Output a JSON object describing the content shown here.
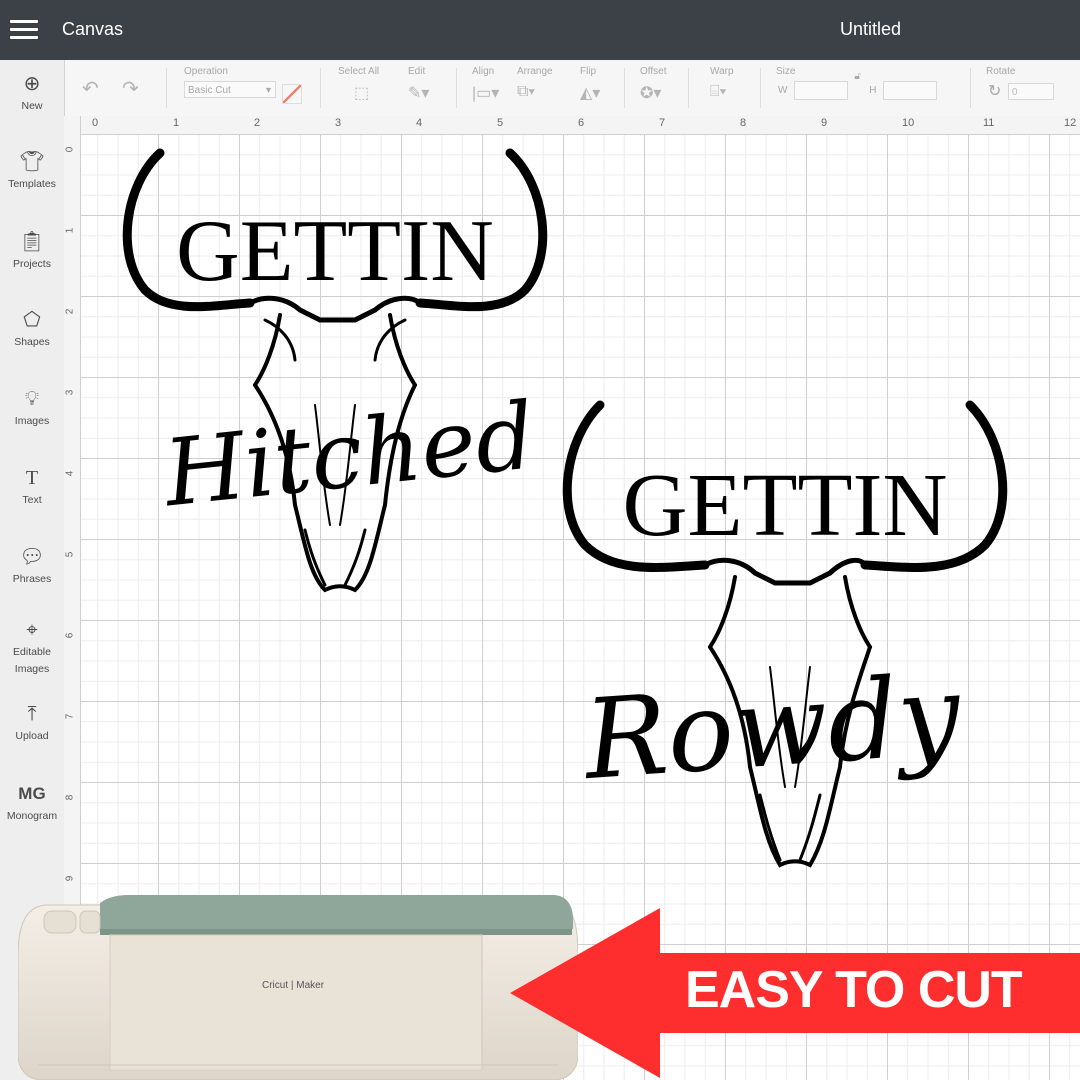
{
  "header": {
    "app_title": "Canvas",
    "doc_title": "Untitled"
  },
  "toolbar": {
    "operation_label": "Operation",
    "operation_value": "Basic Cut",
    "select_all_label": "Select All",
    "edit_label": "Edit",
    "align_label": "Align",
    "arrange_label": "Arrange",
    "flip_label": "Flip",
    "offset_label": "Offset",
    "warp_label": "Warp",
    "size_label": "Size",
    "size_w": "W",
    "size_h": "H",
    "rotate_label": "Rotate",
    "rotate_value": "0"
  },
  "sidebar": {
    "items": [
      {
        "label": "New",
        "icon": "plus-circle-icon"
      },
      {
        "label": "Templates",
        "icon": "shirt-icon"
      },
      {
        "label": "Projects",
        "icon": "clipboard-icon"
      },
      {
        "label": "Shapes",
        "icon": "shapes-icon"
      },
      {
        "label": "Images",
        "icon": "lightbulb-icon"
      },
      {
        "label": "Text",
        "icon": "text-icon"
      },
      {
        "label": "Phrases",
        "icon": "speech-bubble-icon"
      },
      {
        "label": "Editable Images",
        "icon": "editable-images-icon"
      },
      {
        "label": "Upload",
        "icon": "upload-icon"
      },
      {
        "label": "Monogram",
        "icon": "monogram-icon"
      }
    ]
  },
  "ruler": {
    "top": [
      "0",
      "1",
      "2",
      "3",
      "4",
      "5",
      "6",
      "7",
      "8",
      "9",
      "10",
      "11",
      "12"
    ],
    "left": [
      "0",
      "1",
      "2",
      "3",
      "4",
      "5",
      "6",
      "7",
      "8",
      "9"
    ]
  },
  "designs": {
    "left": {
      "word1": "GETTIN",
      "word2": "Hitched"
    },
    "right": {
      "word1": "GETTIN",
      "word2": "Rowdy"
    }
  },
  "machine": {
    "brand": "Cricut | Maker"
  },
  "banner": {
    "text": "EASY TO CUT",
    "color": "#ff2e2e"
  }
}
